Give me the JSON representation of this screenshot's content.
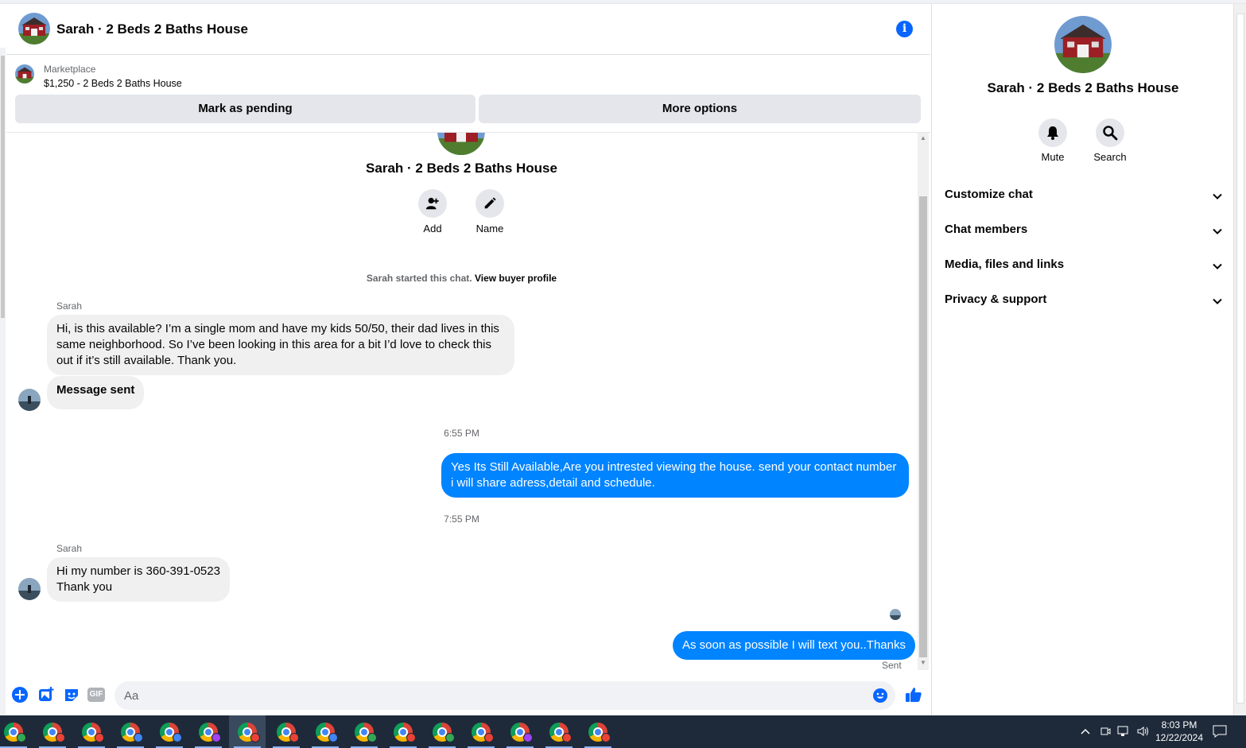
{
  "header": {
    "title": "Sarah · 2 Beds 2 Baths House"
  },
  "marketplace": {
    "label": "Marketplace",
    "listing": "$1,250 - 2 Beds 2 Baths House",
    "mark_pending": "Mark as pending",
    "more_options": "More options"
  },
  "thread": {
    "title": "Sarah · 2 Beds 2 Baths House",
    "add_label": "Add",
    "name_label": "Name",
    "system_text": "Sarah started this chat.",
    "system_link": "View buyer profile",
    "messages": [
      {
        "sender": "Sarah",
        "text": "Hi, is this available? I’m a single mom and have my kids 50/50, their dad lives in this same neighborhood.   So I’ve been looking in this area for a bit  I’d love to check this out if it’s still available.  Thank you."
      },
      {
        "text": "Message sent"
      },
      {
        "time": "6:55 PM"
      },
      {
        "text": "Yes Its Still Available,Are you intrested viewing the house. send your contact number i will share adress,detail and schedule."
      },
      {
        "time": "7:55 PM"
      },
      {
        "sender": "Sarah",
        "line1": "Hi my number is 360-391-0523",
        "line2": "Thank you"
      },
      {
        "text": "As soon as possible I will text you..Thanks",
        "status": "Sent"
      }
    ]
  },
  "composer": {
    "placeholder": "Aa",
    "gif": "GIF"
  },
  "panel": {
    "title": "Sarah · 2 Beds 2 Baths House",
    "mute": "Mute",
    "search": "Search",
    "sections": [
      "Customize chat",
      "Chat members",
      "Media, files and links",
      "Privacy & support"
    ]
  },
  "taskbar": {
    "time": "8:03 PM",
    "date": "12/22/2024",
    "badge_colors": [
      "#34a853",
      "#ea4335",
      "#ea4335",
      "#4285f4",
      "#4285f4",
      "#a142f4",
      "#ea4335",
      "#ea4335",
      "#4285f4",
      "#34a853",
      "#ea4335",
      "#34a853",
      "#ea4335",
      "#a142f4",
      "#ea4335",
      "#ea4335"
    ]
  },
  "colors": {
    "accent": "#0084ff",
    "info": "#0866ff"
  }
}
